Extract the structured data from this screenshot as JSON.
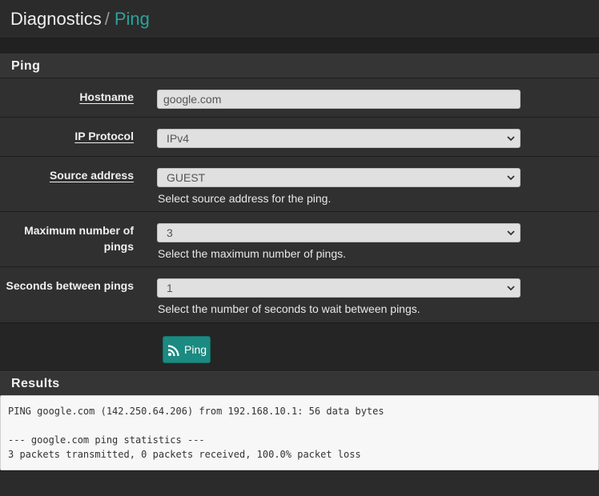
{
  "breadcrumb": {
    "root": "Diagnostics",
    "separator": "/",
    "current": "Ping"
  },
  "ping_panel": {
    "title": "Ping",
    "hostname": {
      "label": "Hostname",
      "value": "google.com"
    },
    "ip_protocol": {
      "label": "IP Protocol",
      "selected": "IPv4"
    },
    "source_address": {
      "label": "Source address",
      "selected": "GUEST",
      "help": "Select source address for the ping."
    },
    "max_pings": {
      "label_line1": "Maximum number of",
      "label_line2": "pings",
      "selected": "3",
      "help": "Select the maximum number of pings."
    },
    "seconds_between": {
      "label": "Seconds between pings",
      "selected": "1",
      "help": "Select the number of seconds to wait between pings."
    },
    "ping_button": {
      "label": "Ping",
      "icon": "rss-icon"
    }
  },
  "results_panel": {
    "title": "Results",
    "lines": [
      "PING google.com (142.250.64.206) from 192.168.10.1: 56 data bytes",
      "",
      "--- google.com ping statistics ---",
      "3 packets transmitted, 0 packets received, 100.0% packet loss"
    ]
  },
  "colors": {
    "accent": "#2aa39a",
    "button": "#1b8a80",
    "background": "#212121"
  }
}
